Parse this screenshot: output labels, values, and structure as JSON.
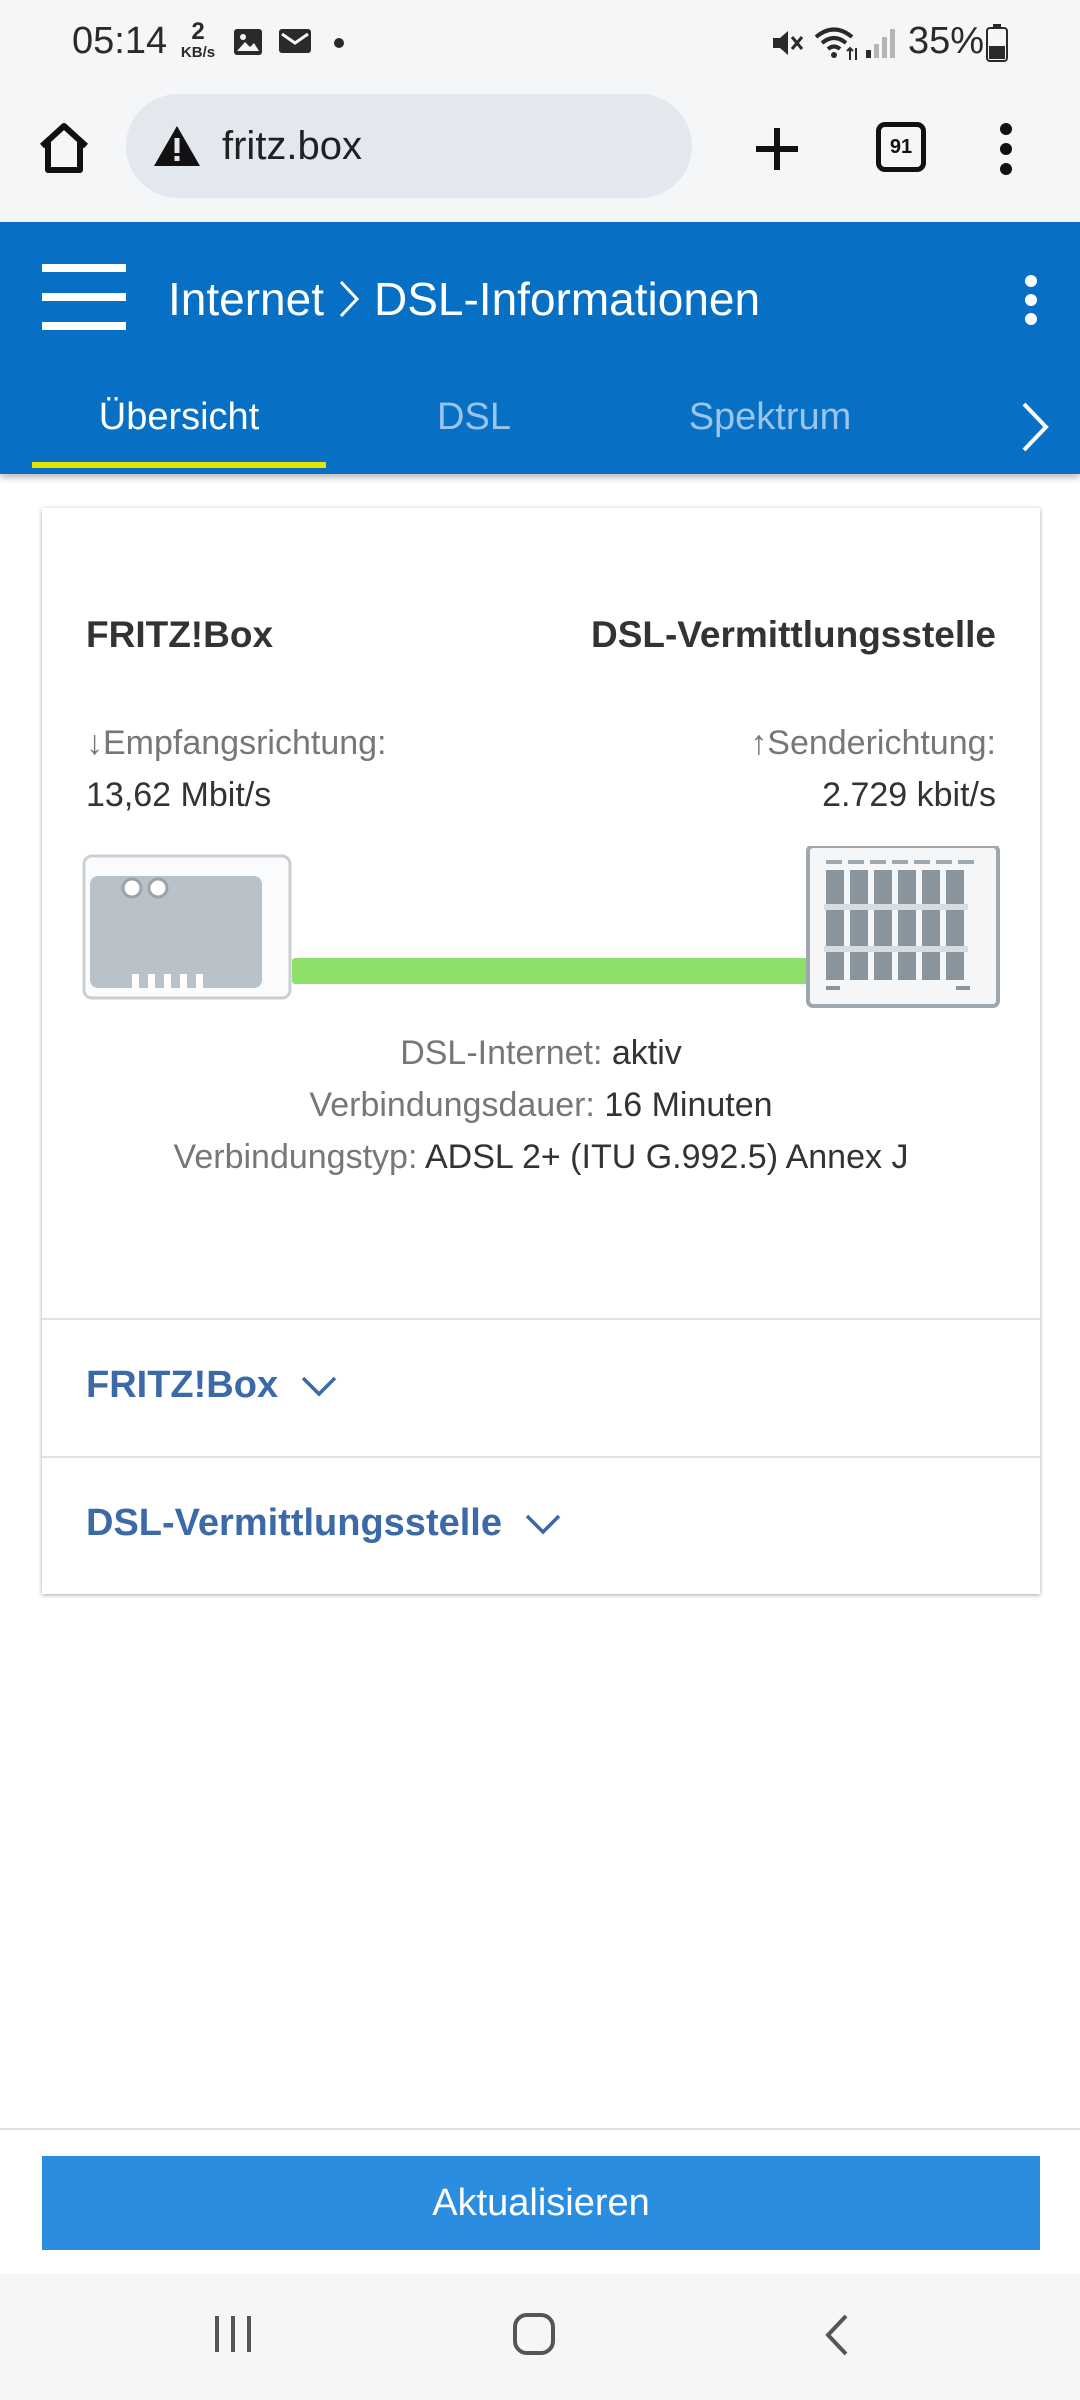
{
  "status_bar": {
    "time": "05:14",
    "net_speed_value": "2",
    "net_speed_unit": "KB/s",
    "battery": "35%",
    "icons": [
      "image-icon",
      "mail-icon",
      "dot-icon",
      "mute-icon",
      "wifi-icon",
      "signal-icon",
      "battery-icon"
    ]
  },
  "browser": {
    "url": "fritz.box",
    "tab_count": "91",
    "icons": [
      "home-icon",
      "warning-icon",
      "new-tab-icon",
      "tabs-icon",
      "menu-icon"
    ]
  },
  "header": {
    "crumb_parent": "Internet",
    "crumb_current": "DSL-Informationen",
    "tabs": [
      {
        "label": "Übersicht",
        "active": true
      },
      {
        "label": "DSL",
        "active": false
      },
      {
        "label": "Spektrum",
        "active": false
      }
    ],
    "colors": {
      "bar": "#0770c5",
      "tab_indicator": "#e3e600"
    }
  },
  "overview": {
    "left_title": "FRITZ!Box",
    "right_title": "DSL-Vermittlungsstelle",
    "downstream_label": "↓Empfangsrichtung:",
    "downstream_value": "13,62 Mbit/s",
    "upstream_label": "↑Senderichtung:",
    "upstream_value": "2.729 kbit/s",
    "line_color": "#8fe06a",
    "info": [
      {
        "label": "DSL-Internet:",
        "value": "aktiv"
      },
      {
        "label": "Verbindungsdauer:",
        "value": "16 Minuten"
      },
      {
        "label": "Verbindungstyp:",
        "value": "ADSL 2+ (ITU G.992.5) Annex J"
      }
    ],
    "expanders": [
      {
        "label": "FRITZ!Box"
      },
      {
        "label": "DSL-Vermittlungsstelle"
      }
    ]
  },
  "actions": {
    "refresh_label": "Aktualisieren"
  },
  "nav_bar": {
    "icons": [
      "recents-icon",
      "home-nav-icon",
      "back-icon"
    ]
  }
}
